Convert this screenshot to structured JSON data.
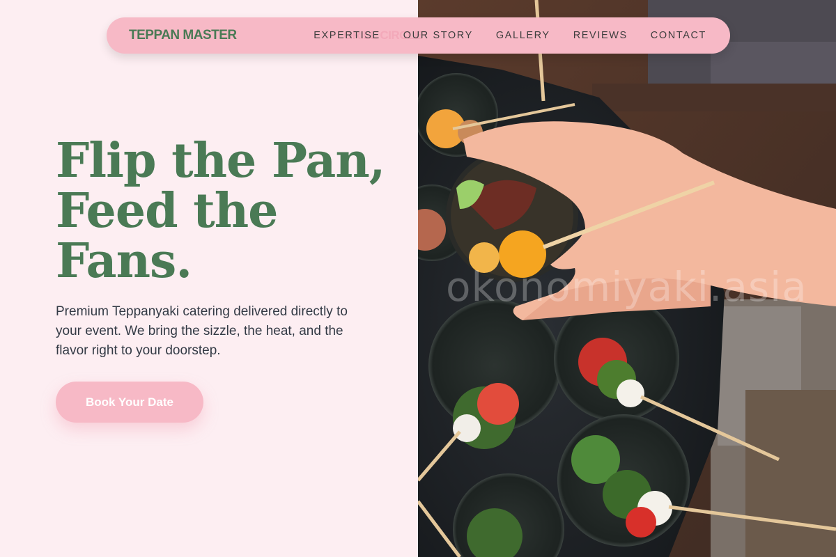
{
  "nav": {
    "brand": "TEPPAN MASTER",
    "brand_ghost": "GRILL CIRCLE",
    "links": [
      "EXPERTISE",
      "OUR STORY",
      "GALLERY",
      "REVIEWS",
      "CONTACT"
    ]
  },
  "hero": {
    "headline_line1": "Flip the Pan,",
    "headline_line2": "Feed the",
    "headline_line3": "Fans.",
    "subtext": "Premium Teppanyaki catering delivered directly to your event. We bring the sizzle, the heat, and the flavor right to your doorstep.",
    "cta_label": "Book Your Date"
  },
  "photo": {
    "watermark": "okonomiyaki.asia",
    "subject": "hand-holding-appetizer-cup-photo"
  },
  "colors": {
    "background": "#fdeef2",
    "accent_pink": "#f7b9c6",
    "brand_green": "#4a7a55",
    "body_text": "#333a45"
  }
}
